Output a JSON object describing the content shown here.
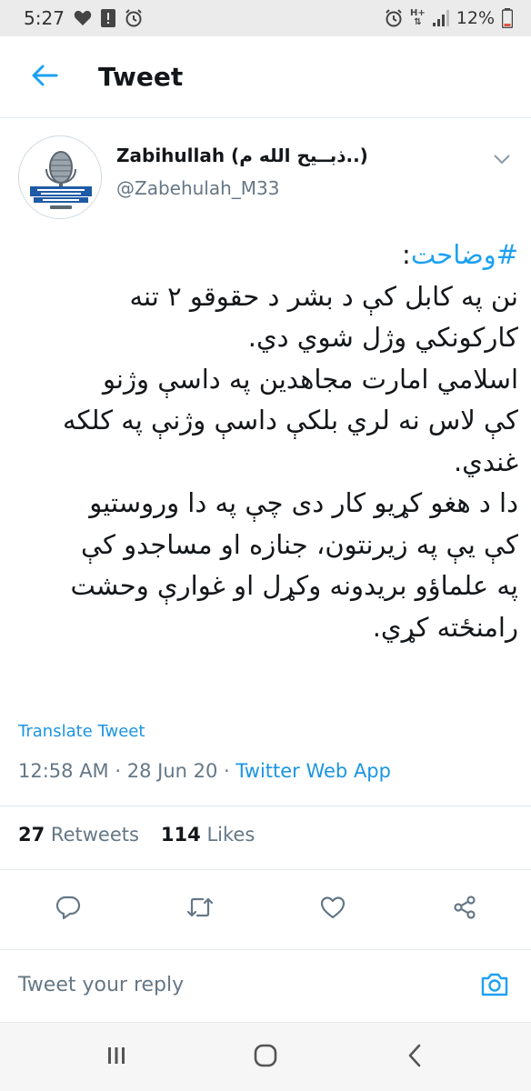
{
  "status_bar": {
    "time": "5:27",
    "network": "H+",
    "battery": "12%",
    "left_icons": [
      "heart-icon",
      "alert-icon",
      "alarm-icon"
    ],
    "right_icons": [
      "alarm-icon",
      "data-arrows-icon",
      "signal-icon",
      "battery-icon"
    ]
  },
  "header": {
    "title": "Tweet"
  },
  "author": {
    "display_name": "Zabihullah (ذبــيح الله م..)",
    "handle": "@Zabehulah_M33"
  },
  "tweet": {
    "hashtag": "#وضاحت",
    "hashtag_suffix": ":",
    "lines": [
      "نن په کابل کې د بشر د حقوقو ۲ تنه",
      "کارکونکي وژل شوي دي.",
      "اسلامي امارت مجاهدين په داسې وژنو",
      "کې لاس نه لري بلکې داسې وژنې په کلکه",
      "غندي.",
      "دا د هغو کړيو کار دی چې په دا وروستيو",
      "کې يې په زيرنتون، جنازه او مساجدو کې",
      "په علماؤو بريدونه وکړل او غوارې وحشت",
      "رامنځته کړي."
    ],
    "translate_label": "Translate Tweet",
    "time": "12:58 AM",
    "date": "28 Jun 20",
    "separator": "·",
    "source": "Twitter Web App"
  },
  "stats": {
    "retweets_count": "27",
    "retweets_label": "Retweets",
    "likes_count": "114",
    "likes_label": "Likes"
  },
  "actions": [
    "reply-icon",
    "retweet-icon",
    "like-icon",
    "share-icon"
  ],
  "reply": {
    "placeholder": "Tweet your reply"
  },
  "colors": {
    "accent": "#1da1f2",
    "text_primary": "#14171a",
    "text_secondary": "#657786",
    "divider": "#e1e8ed"
  }
}
